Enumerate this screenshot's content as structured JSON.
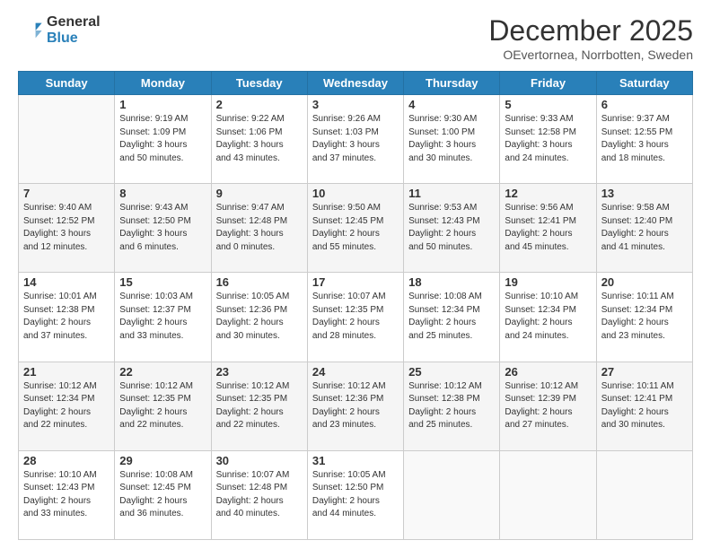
{
  "logo": {
    "general": "General",
    "blue": "Blue"
  },
  "header": {
    "month": "December 2025",
    "location": "OEvertornea, Norrbotten, Sweden"
  },
  "days_of_week": [
    "Sunday",
    "Monday",
    "Tuesday",
    "Wednesday",
    "Thursday",
    "Friday",
    "Saturday"
  ],
  "weeks": [
    [
      {
        "day": "",
        "info": ""
      },
      {
        "day": "1",
        "info": "Sunrise: 9:19 AM\nSunset: 1:09 PM\nDaylight: 3 hours\nand 50 minutes."
      },
      {
        "day": "2",
        "info": "Sunrise: 9:22 AM\nSunset: 1:06 PM\nDaylight: 3 hours\nand 43 minutes."
      },
      {
        "day": "3",
        "info": "Sunrise: 9:26 AM\nSunset: 1:03 PM\nDaylight: 3 hours\nand 37 minutes."
      },
      {
        "day": "4",
        "info": "Sunrise: 9:30 AM\nSunset: 1:00 PM\nDaylight: 3 hours\nand 30 minutes."
      },
      {
        "day": "5",
        "info": "Sunrise: 9:33 AM\nSunset: 12:58 PM\nDaylight: 3 hours\nand 24 minutes."
      },
      {
        "day": "6",
        "info": "Sunrise: 9:37 AM\nSunset: 12:55 PM\nDaylight: 3 hours\nand 18 minutes."
      }
    ],
    [
      {
        "day": "7",
        "info": "Sunrise: 9:40 AM\nSunset: 12:52 PM\nDaylight: 3 hours\nand 12 minutes."
      },
      {
        "day": "8",
        "info": "Sunrise: 9:43 AM\nSunset: 12:50 PM\nDaylight: 3 hours\nand 6 minutes."
      },
      {
        "day": "9",
        "info": "Sunrise: 9:47 AM\nSunset: 12:48 PM\nDaylight: 3 hours\nand 0 minutes."
      },
      {
        "day": "10",
        "info": "Sunrise: 9:50 AM\nSunset: 12:45 PM\nDaylight: 2 hours\nand 55 minutes."
      },
      {
        "day": "11",
        "info": "Sunrise: 9:53 AM\nSunset: 12:43 PM\nDaylight: 2 hours\nand 50 minutes."
      },
      {
        "day": "12",
        "info": "Sunrise: 9:56 AM\nSunset: 12:41 PM\nDaylight: 2 hours\nand 45 minutes."
      },
      {
        "day": "13",
        "info": "Sunrise: 9:58 AM\nSunset: 12:40 PM\nDaylight: 2 hours\nand 41 minutes."
      }
    ],
    [
      {
        "day": "14",
        "info": "Sunrise: 10:01 AM\nSunset: 12:38 PM\nDaylight: 2 hours\nand 37 minutes."
      },
      {
        "day": "15",
        "info": "Sunrise: 10:03 AM\nSunset: 12:37 PM\nDaylight: 2 hours\nand 33 minutes."
      },
      {
        "day": "16",
        "info": "Sunrise: 10:05 AM\nSunset: 12:36 PM\nDaylight: 2 hours\nand 30 minutes."
      },
      {
        "day": "17",
        "info": "Sunrise: 10:07 AM\nSunset: 12:35 PM\nDaylight: 2 hours\nand 28 minutes."
      },
      {
        "day": "18",
        "info": "Sunrise: 10:08 AM\nSunset: 12:34 PM\nDaylight: 2 hours\nand 25 minutes."
      },
      {
        "day": "19",
        "info": "Sunrise: 10:10 AM\nSunset: 12:34 PM\nDaylight: 2 hours\nand 24 minutes."
      },
      {
        "day": "20",
        "info": "Sunrise: 10:11 AM\nSunset: 12:34 PM\nDaylight: 2 hours\nand 23 minutes."
      }
    ],
    [
      {
        "day": "21",
        "info": "Sunrise: 10:12 AM\nSunset: 12:34 PM\nDaylight: 2 hours\nand 22 minutes."
      },
      {
        "day": "22",
        "info": "Sunrise: 10:12 AM\nSunset: 12:35 PM\nDaylight: 2 hours\nand 22 minutes."
      },
      {
        "day": "23",
        "info": "Sunrise: 10:12 AM\nSunset: 12:35 PM\nDaylight: 2 hours\nand 22 minutes."
      },
      {
        "day": "24",
        "info": "Sunrise: 10:12 AM\nSunset: 12:36 PM\nDaylight: 2 hours\nand 23 minutes."
      },
      {
        "day": "25",
        "info": "Sunrise: 10:12 AM\nSunset: 12:38 PM\nDaylight: 2 hours\nand 25 minutes."
      },
      {
        "day": "26",
        "info": "Sunrise: 10:12 AM\nSunset: 12:39 PM\nDaylight: 2 hours\nand 27 minutes."
      },
      {
        "day": "27",
        "info": "Sunrise: 10:11 AM\nSunset: 12:41 PM\nDaylight: 2 hours\nand 30 minutes."
      }
    ],
    [
      {
        "day": "28",
        "info": "Sunrise: 10:10 AM\nSunset: 12:43 PM\nDaylight: 2 hours\nand 33 minutes."
      },
      {
        "day": "29",
        "info": "Sunrise: 10:08 AM\nSunset: 12:45 PM\nDaylight: 2 hours\nand 36 minutes."
      },
      {
        "day": "30",
        "info": "Sunrise: 10:07 AM\nSunset: 12:48 PM\nDaylight: 2 hours\nand 40 minutes."
      },
      {
        "day": "31",
        "info": "Sunrise: 10:05 AM\nSunset: 12:50 PM\nDaylight: 2 hours\nand 44 minutes."
      },
      {
        "day": "",
        "info": ""
      },
      {
        "day": "",
        "info": ""
      },
      {
        "day": "",
        "info": ""
      }
    ]
  ]
}
